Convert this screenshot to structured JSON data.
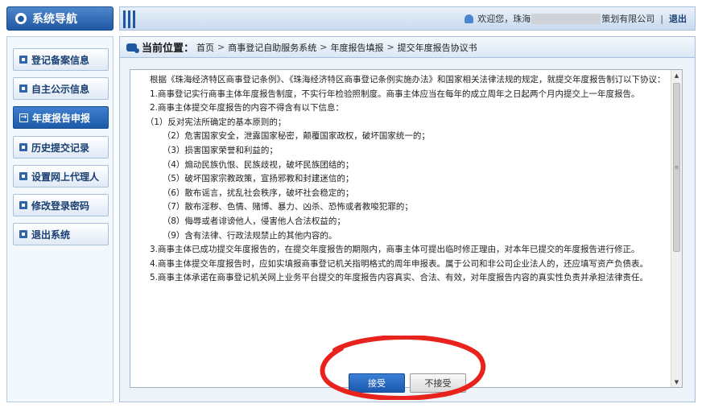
{
  "sidebar": {
    "title": "系统导航",
    "items": [
      {
        "label": "登记备案信息",
        "active": false
      },
      {
        "label": "自主公示信息",
        "active": false
      },
      {
        "label": "年度报告申报",
        "active": true
      },
      {
        "label": "历史提交记录",
        "active": false
      },
      {
        "label": "设置网上代理人",
        "active": false
      },
      {
        "label": "修改登录密码",
        "active": false
      },
      {
        "label": "退出系统",
        "active": false
      }
    ]
  },
  "header": {
    "welcome_prefix": "欢迎您，珠海",
    "welcome_suffix": "策划有限公司",
    "separator": "|",
    "logout_label": "退出"
  },
  "breadcrumb": {
    "label": "当前位置：",
    "items": [
      "首页",
      "商事登记自助服务系统",
      "年度报告填报",
      "提交年度报告协议书"
    ],
    "separator": ">"
  },
  "agreement": {
    "paragraphs": [
      "　　根据《珠海经济特区商事登记条例》、《珠海经济特区商事登记条例实施办法》和国家相关法律法规的规定，就提交年度报告制订以下协议：",
      "　　1.商事登记实行商事主体年度报告制度，不实行年检验照制度。商事主体应当在每年的成立周年之日起两个月内提交上一年度报告。",
      "　　2.商事主体提交年度报告的内容不得含有以下信息：",
      "　　（1）反对宪法所确定的基本原则的；",
      "　　　　（2）危害国家安全，泄露国家秘密，颠覆国家政权，破坏国家统一的；",
      "　　　　（3）损害国家荣誉和利益的；",
      "　　　　（4）煽动民族仇恨、民族歧视，破坏民族团结的；",
      "　　　　（5）破坏国家宗教政策，宣扬邪教和封建迷信的；",
      "　　　　（6）散布谣言，扰乱社会秩序，破坏社会稳定的；",
      "　　　　（7）散布淫秽、色情、赌博、暴力、凶杀、恐怖或者教唆犯罪的；",
      "　　　　（8）侮辱或者诽谤他人，侵害他人合法权益的；",
      "　　　　（9）含有法律、行政法规禁止的其他内容的。",
      "　　3.商事主体已成功提交年度报告的，在提交年度报告的期限内，商事主体可提出临时修正理由，对本年已提交的年度报告进行修正。",
      "　　4.商事主体提交年度报告时，应如实填报商事登记机关指明格式的周年申报表。属于公司和非公司企业法人的，还应填写资产负债表。",
      "　　5.商事主体承诺在商事登记机关网上业务平台提交的年度报告内容真实、合法、有效，对年度报告内容的真实性负责并承担法律责任。"
    ]
  },
  "buttons": {
    "accept_label": "接受",
    "decline_label": "不接受"
  },
  "colors": {
    "brand_blue": "#1f57a3",
    "annotation_red": "#e8231d"
  },
  "icons": {
    "sidebar_title_icon": "nav-icon",
    "user_icon": "user-icon",
    "breadcrumb_icon": "chat-bubble-icon",
    "menu_item_icon": "square-bullet-icon",
    "active_menu_icon": "arrow-box-icon"
  }
}
